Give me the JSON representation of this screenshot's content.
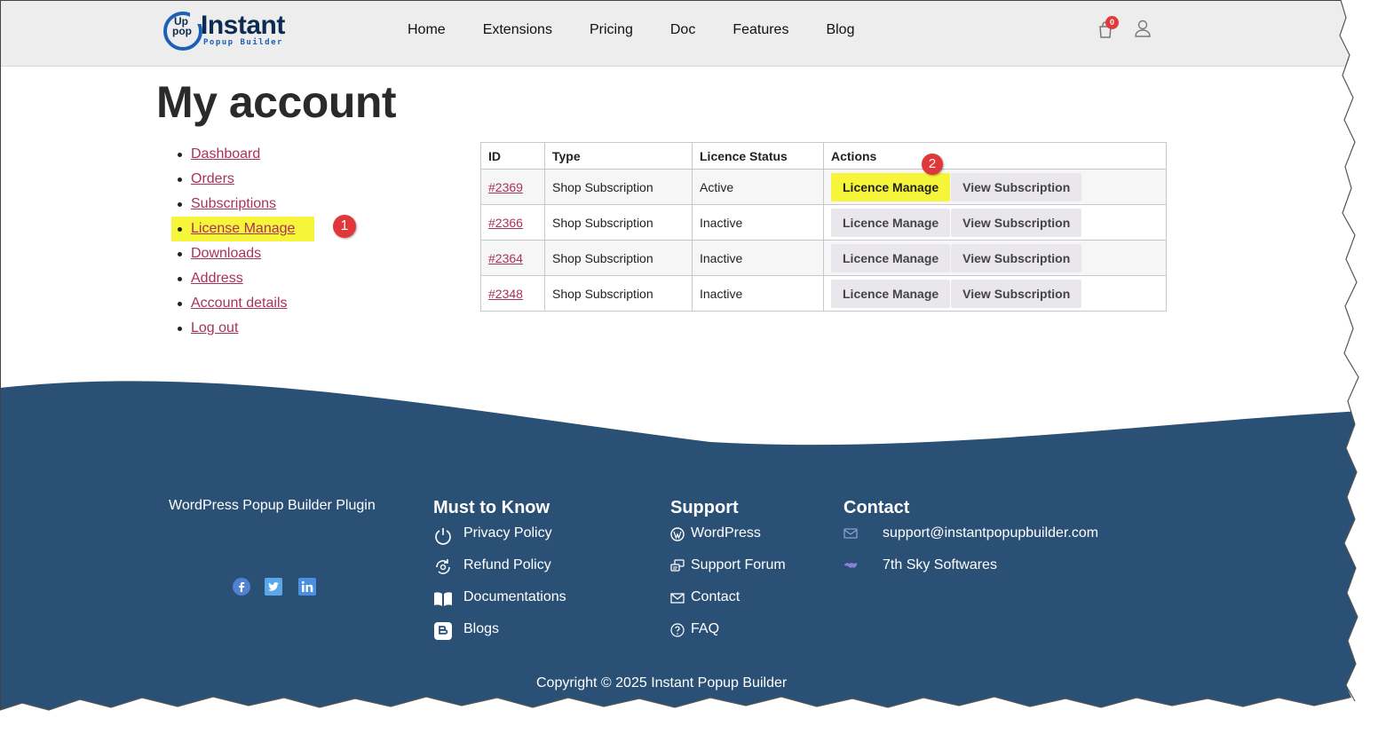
{
  "header": {
    "logo": {
      "badge_top": "Up",
      "badge_bottom": "pop",
      "title": "Instant",
      "subtitle": "Popup Builder"
    },
    "nav": [
      {
        "label": "Home"
      },
      {
        "label": "Extensions"
      },
      {
        "label": "Pricing"
      },
      {
        "label": "Doc"
      },
      {
        "label": "Features"
      },
      {
        "label": "Blog"
      }
    ],
    "cart_count": "0",
    "icons": {
      "cart": "cart-icon",
      "user": "user-icon"
    }
  },
  "main": {
    "title": "My account",
    "sidebar": [
      {
        "label": "Dashboard"
      },
      {
        "label": "Orders"
      },
      {
        "label": "Subscriptions"
      },
      {
        "label": "License Manage",
        "highlighted": true
      },
      {
        "label": "Downloads"
      },
      {
        "label": "Address"
      },
      {
        "label": "Account details"
      },
      {
        "label": "Log out"
      }
    ],
    "table": {
      "headers": [
        "ID",
        "Type",
        "Licence Status",
        "Actions"
      ],
      "rows": [
        {
          "id": "#2369",
          "type": "Shop Subscription",
          "status": "Active",
          "manage": "Licence Manage",
          "view": "View Subscription"
        },
        {
          "id": "#2366",
          "type": "Shop Subscription",
          "status": "Inactive",
          "manage": "Licence Manage",
          "view": "View Subscription"
        },
        {
          "id": "#2364",
          "type": "Shop Subscription",
          "status": "Inactive",
          "manage": "Licence Manage",
          "view": "View Subscription"
        },
        {
          "id": "#2348",
          "type": "Shop Subscription",
          "status": "Inactive",
          "manage": "Licence Manage",
          "view": "View Subscription"
        }
      ]
    },
    "markers": [
      "1",
      "2"
    ]
  },
  "footer": {
    "tagline": "WordPress Popup Builder Plugin",
    "social": [
      "facebook-icon",
      "twitter-icon",
      "linkedin-icon"
    ],
    "must_know": {
      "heading": "Must to Know",
      "items": [
        {
          "label": "Privacy Policy",
          "icon": "power-icon"
        },
        {
          "label": "Refund Policy",
          "icon": "refund-icon"
        },
        {
          "label": "Documentations",
          "icon": "book-icon"
        },
        {
          "label": "Blogs",
          "icon": "blogger-icon"
        }
      ]
    },
    "support": {
      "heading": "Support",
      "items": [
        {
          "label": "WordPress",
          "icon": "wordpress-icon"
        },
        {
          "label": "Support Forum",
          "icon": "forum-icon"
        },
        {
          "label": "Contact",
          "icon": "envelope-icon"
        },
        {
          "label": "FAQ",
          "icon": "question-icon"
        }
      ]
    },
    "contact": {
      "heading": "Contact",
      "items": [
        {
          "label": "support@instantpopupbuilder.com",
          "icon": "envelope-icon"
        },
        {
          "label": "7th Sky Softwares",
          "icon": "handshake-icon"
        }
      ]
    },
    "copyright": "Copyright © 2025 Instant Popup Builder"
  },
  "colors": {
    "header_bg": "#ededed",
    "footer_bg": "#2b5075",
    "link": "#a8325e",
    "highlight": "#f6f53a",
    "marker": "#e0383a"
  }
}
